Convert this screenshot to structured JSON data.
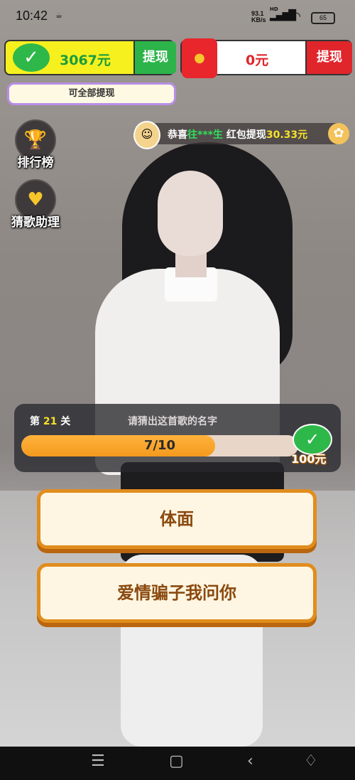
{
  "status_bar": {
    "time": "10:42",
    "speed_value": "93.1",
    "speed_unit": "KB/s",
    "net_type": "HD",
    "battery": "65"
  },
  "wallet": {
    "amount": "3067元",
    "withdraw_label": "提现",
    "tip": "可全部提现"
  },
  "red_packet": {
    "amount": "0元",
    "withdraw_label": "提现"
  },
  "sidebar": {
    "leaderboard_label": "排行榜",
    "assistant_label": "猜歌助理"
  },
  "ticker": {
    "prefix": "恭喜",
    "user": "往***生",
    "middle": " 红包提现",
    "amount": "30.33元"
  },
  "quiz": {
    "level_prefix": "第",
    "level_number": "21",
    "level_suffix": "关",
    "question": "请猜出这首歌的名字",
    "progress_text": "7/10",
    "progress_fraction": 0.7,
    "reward": "100元"
  },
  "answers": [
    {
      "label": "体面"
    },
    {
      "label": "爱情骗子我问你"
    }
  ],
  "colors": {
    "wallet_bg": "#f6f01f",
    "wechat_green": "#2cb44a",
    "red": "#e0252b",
    "answer_border": "#e18d1d",
    "progress": "#f49a1e"
  },
  "icons": {
    "wallet": "wechat-check-icon",
    "red_packet": "red-envelope-icon",
    "leaderboard": "trophy-icon",
    "assistant": "heart-chat-icon",
    "settings": "gear-icon"
  }
}
